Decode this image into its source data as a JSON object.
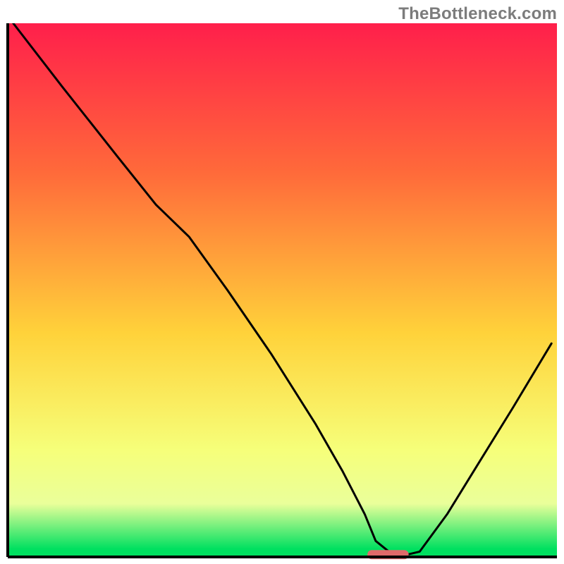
{
  "watermark": "TheBottleneck.com",
  "colors": {
    "frame_stroke": "#000000",
    "curve_stroke": "#000000",
    "marker_fill": "#e06a6a",
    "gradient": {
      "top": "#ff1f4b",
      "upper": "#ff6a3a",
      "mid": "#ffd23a",
      "lower": "#f6ff7a",
      "band": "#eaff9a",
      "bottom": "#00e060"
    }
  },
  "chart_data": {
    "type": "line",
    "title": "",
    "xlabel": "",
    "ylabel": "",
    "xlim": [
      0,
      100
    ],
    "ylim": [
      0,
      100
    ],
    "grid": false,
    "legend": false,
    "series": [
      {
        "name": "bottleneck-curve",
        "x": [
          1,
          10,
          20,
          27,
          33,
          40,
          48,
          56,
          61,
          65,
          67,
          70,
          73,
          75,
          80,
          86,
          92,
          99
        ],
        "values": [
          100,
          88,
          75,
          66,
          60,
          50,
          38,
          25,
          16,
          8,
          3,
          0.5,
          0.5,
          1,
          8,
          18,
          28,
          40
        ]
      }
    ],
    "annotations": [
      {
        "name": "optimal-marker",
        "shape": "rounded-rect",
        "x_start": 65.5,
        "x_end": 73,
        "y": 0.5
      }
    ]
  }
}
